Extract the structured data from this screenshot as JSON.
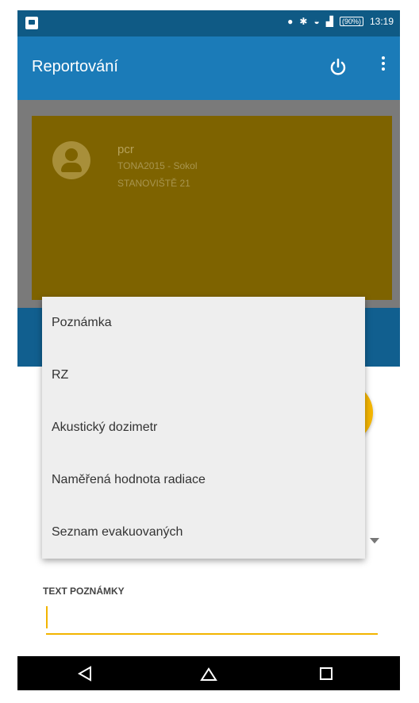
{
  "status_bar": {
    "battery": "(90%)",
    "time": "13:19"
  },
  "app_bar": {
    "title": "Reportování"
  },
  "profile": {
    "name": "pcr",
    "event": "TONA2015 - Sokol",
    "station": "STANOVIŠTĚ 21"
  },
  "form": {
    "text_label": "TEXT POZNÁMKY",
    "text_value": ""
  },
  "menu": {
    "items": [
      {
        "label": "Poznámka"
      },
      {
        "label": "RZ"
      },
      {
        "label": "Akustický dozimetr"
      },
      {
        "label": "Naměřená hodnota radiace"
      },
      {
        "label": "Seznam evakuovaných"
      }
    ]
  },
  "colors": {
    "status_bar": "#0f5a85",
    "app_bar": "#1b7bb8",
    "accent": "#f5b601",
    "profile_card": "#7e6300"
  },
  "icons": {
    "status_left": "notification-icon",
    "fab": "check-icon",
    "nav": [
      "back-icon",
      "home-icon",
      "recent-apps-icon"
    ]
  }
}
